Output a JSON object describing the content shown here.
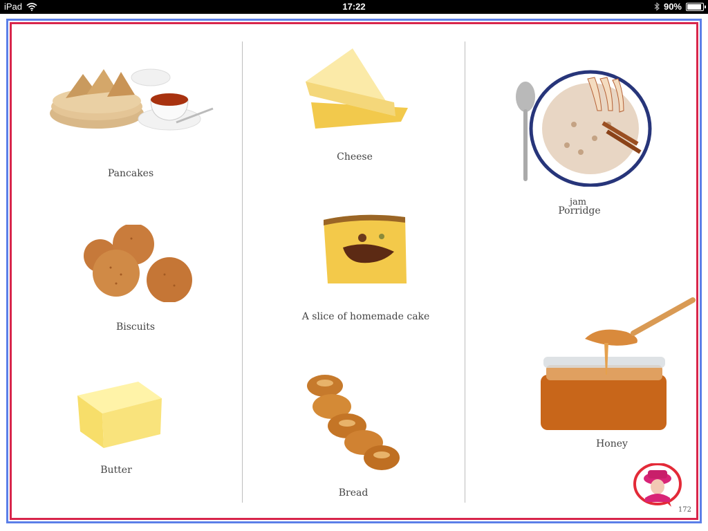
{
  "status_bar": {
    "device": "iPad",
    "time": "17:22",
    "battery": "90%",
    "battery_level": 0.9
  },
  "items": {
    "pancakes": "Pancakes",
    "biscuits": "Biscuits",
    "butter": "Butter",
    "cheese": "Cheese",
    "cake": "A slice of homemade cake",
    "bread": "Bread",
    "porridge_overlap": "jam",
    "porridge": "Porridge",
    "honey": "Honey"
  },
  "page_number": "172",
  "icons": [
    "wifi-icon",
    "bluetooth-icon",
    "battery-icon",
    "queen-speech-bubble-icon"
  ],
  "colors": {
    "outer_border": "#5b7fe8",
    "inner_border": "#d8254b"
  }
}
